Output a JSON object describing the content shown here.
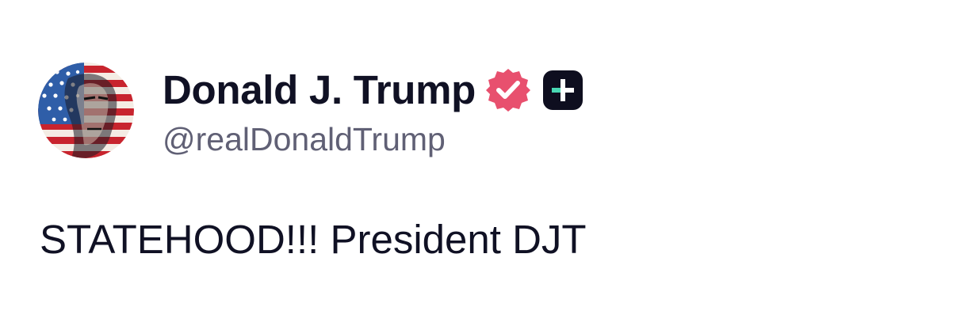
{
  "post": {
    "author": {
      "display_name": "Donald J. Trump",
      "handle": "@realDonaldTrump",
      "verified_icon": "verified-badge-icon",
      "verified_color": "#e8506e",
      "plus_icon": "plus-badge-icon",
      "plus_badge_bg": "#0e0e1f",
      "plus_badge_accent": "#4ad8b4"
    },
    "text": "STATEHOOD!!! President DJT"
  },
  "colors": {
    "name_text": "#101124",
    "handle_text": "#606075",
    "body_text": "#101124",
    "background": "#ffffff"
  }
}
